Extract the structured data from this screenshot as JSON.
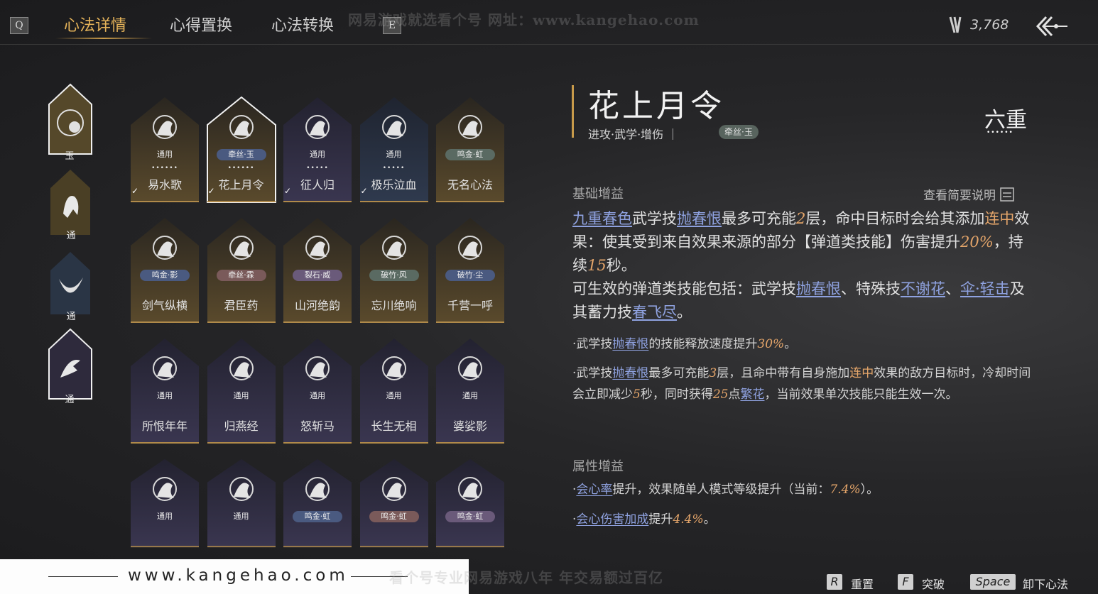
{
  "topbar": {
    "key_q": "Q",
    "key_e": "E",
    "tabs": [
      {
        "label": "心法详情",
        "active": true
      },
      {
        "label": "心得置换",
        "active": false
      },
      {
        "label": "心法转换",
        "active": false
      }
    ],
    "watermark_top": "网易游戏就选看个号   网址：www.kangehao.com",
    "currency_value": "3,768",
    "currency_icon": "arrows-icon",
    "back_icon": "back-arrow-icon"
  },
  "side_slots": [
    {
      "label": "玉",
      "icon": "flower-emblem",
      "selected": true
    },
    {
      "label": "通",
      "icon": "horse",
      "selected": false
    },
    {
      "label": "通",
      "icon": "crescent-bird",
      "selected": false
    },
    {
      "label": "通",
      "icon": "bird-hand",
      "selected": false
    }
  ],
  "grid": [
    {
      "name": "易水歌",
      "tag": "通用",
      "dots": "••••••",
      "checked": true,
      "tone": "gold"
    },
    {
      "name": "花上月令",
      "tag": "牵丝·玉",
      "dots": "••••••",
      "checked": true,
      "tone": "gold",
      "selected": true
    },
    {
      "name": "征人归",
      "tag": "通用",
      "dots": "•••••",
      "checked": true,
      "tone": "purple"
    },
    {
      "name": "极乐泣血",
      "tag": "通用",
      "dots": "•••••",
      "checked": true,
      "tone": "blue"
    },
    {
      "name": "无名心法",
      "tag": "鸣金·虹",
      "dots": "",
      "checked": false,
      "tone": "gold"
    },
    {
      "name": "剑气纵横",
      "tag": "鸣金·影",
      "dots": "",
      "checked": false,
      "tone": "gold"
    },
    {
      "name": "君臣药",
      "tag": "牵丝·霖",
      "dots": "",
      "checked": false,
      "tone": "gold"
    },
    {
      "name": "山河绝韵",
      "tag": "裂石·威",
      "dots": "",
      "checked": false,
      "tone": "gold"
    },
    {
      "name": "忘川绝响",
      "tag": "破竹·风",
      "dots": "",
      "checked": false,
      "tone": "gold"
    },
    {
      "name": "千营一呼",
      "tag": "破竹·尘",
      "dots": "",
      "checked": false,
      "tone": "gold"
    },
    {
      "name": "所恨年年",
      "tag": "通用",
      "dots": "",
      "checked": false,
      "tone": "purple"
    },
    {
      "name": "归燕经",
      "tag": "通用",
      "dots": "",
      "checked": false,
      "tone": "purple"
    },
    {
      "name": "怒斩马",
      "tag": "通用",
      "dots": "",
      "checked": false,
      "tone": "purple"
    },
    {
      "name": "长生无相",
      "tag": "通用",
      "dots": "",
      "checked": false,
      "tone": "purple"
    },
    {
      "name": "婆娑影",
      "tag": "通用",
      "dots": "",
      "checked": false,
      "tone": "purple"
    },
    {
      "name": "",
      "tag": "通用",
      "dots": "",
      "checked": false,
      "tone": "purple"
    },
    {
      "name": "",
      "tag": "通用",
      "dots": "",
      "checked": false,
      "tone": "purple"
    },
    {
      "name": "",
      "tag": "鸣金·虹",
      "dots": "",
      "checked": false,
      "tone": "purple"
    },
    {
      "name": "",
      "tag": "鸣金·虹",
      "dots": "",
      "checked": false,
      "tone": "purple"
    },
    {
      "name": "",
      "tag": "鸣金·虹",
      "dots": "",
      "checked": false,
      "tone": "purple"
    }
  ],
  "detail": {
    "title": "花上月令",
    "subtitle": "进攻·武学·增伤 ｜",
    "badge": "牵丝·玉",
    "rank": "六重",
    "rank_dots": "••••••",
    "section_base": "基础增益",
    "view_brief": "查看简要说明",
    "section_attr": "属性增益"
  },
  "bottom": {
    "url": "www.kangehao.com",
    "watermark": "看个号专业网易游戏八年   年交易额过百亿",
    "actions": [
      {
        "key": "R",
        "label": "重置"
      },
      {
        "key": "F",
        "label": "突破"
      },
      {
        "key": "Space",
        "label": "卸下心法"
      }
    ]
  },
  "colors": {
    "accent": "#e6b45a",
    "link": "#8fa2e0",
    "number": "#e4a56a"
  }
}
